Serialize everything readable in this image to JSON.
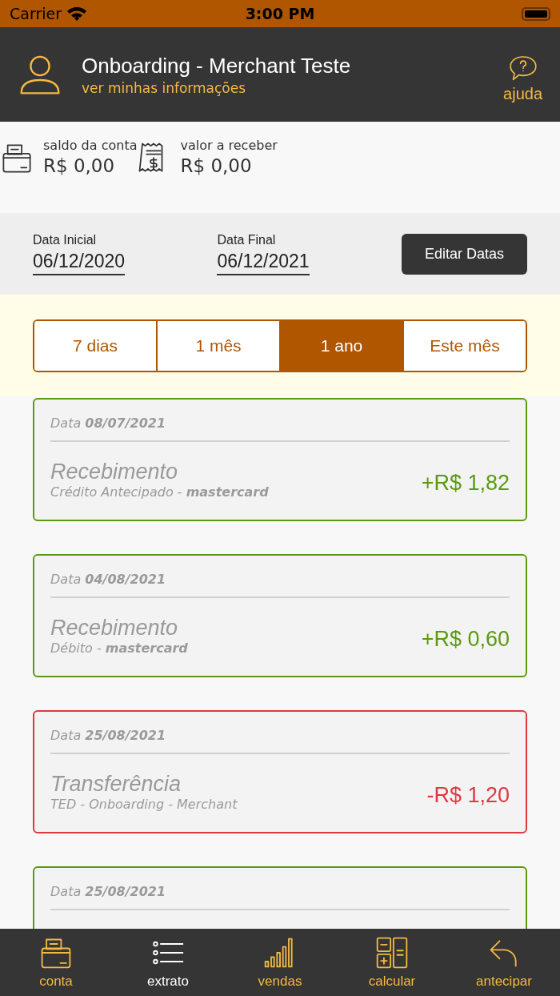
{
  "status_bar": {
    "carrier": "Carrier",
    "time": "3:00 PM"
  },
  "header": {
    "title": "Onboarding - Merchant Teste",
    "subtitle": "ver minhas informações",
    "help": "ajuda"
  },
  "balances": [
    {
      "label": "saldo da conta",
      "value": "R$ 0,00",
      "kind": "wallet"
    },
    {
      "label": "valor a receber",
      "value": "R$ 0,00",
      "kind": "receipt"
    }
  ],
  "dates": {
    "start_label": "Data Inicial",
    "start": "06/12/2020",
    "end_label": "Data Final",
    "end": "06/12/2021",
    "button": "Editar Datas"
  },
  "periods": [
    {
      "label": "7 dias",
      "selected": false
    },
    {
      "label": "1 mês",
      "selected": false
    },
    {
      "label": "1 ano",
      "selected": true
    },
    {
      "label": "Este mês",
      "selected": false
    }
  ],
  "transactions": [
    {
      "kind": "credit",
      "date": "Data **08/07/2021**",
      "title": "Recebimento",
      "detail": "Crédito Antecipado - **mastercard**",
      "amount": "+R$ 1,82"
    },
    {
      "kind": "credit",
      "date": "Data **04/08/2021**",
      "title": "Recebimento",
      "detail": "Débito - **mastercard**",
      "amount": "+R$ 0,60"
    },
    {
      "kind": "debit",
      "date": "Data **25/08/2021**",
      "title": "Transferência",
      "detail": "TED - Onboarding - Merchant",
      "amount": "-R$ 1,20"
    },
    {
      "kind": "credit",
      "date": "Data **25/08/2021**"
    }
  ],
  "tab_bar": [
    {
      "label": "conta",
      "kind": "wallet",
      "selected": false
    },
    {
      "label": "extrato",
      "kind": "list",
      "selected": true
    },
    {
      "label": "vendas",
      "kind": "bars",
      "selected": false
    },
    {
      "label": "calcular",
      "kind": "calculator",
      "selected": false
    },
    {
      "label": "antecipar",
      "kind": "back",
      "selected": false
    }
  ]
}
